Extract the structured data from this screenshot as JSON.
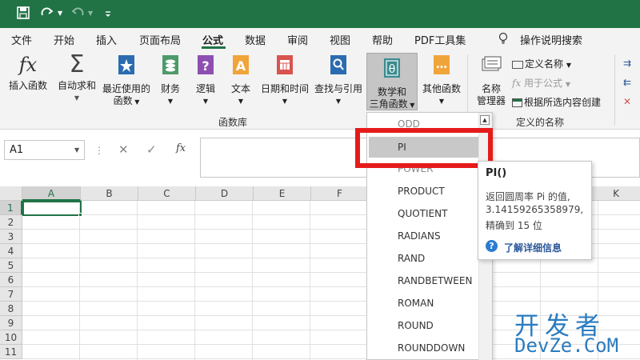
{
  "quick_access": {
    "save_icon": "save-icon",
    "redo_icon": "redo-icon",
    "undo_icon": "undo-icon",
    "customize_icon": "customize-icon"
  },
  "tabs": [
    "文件",
    "开始",
    "插入",
    "页面布局",
    "公式",
    "数据",
    "审阅",
    "视图",
    "帮助",
    "PDF工具集"
  ],
  "active_tab": "公式",
  "tell_me": "操作说明搜索",
  "ribbon": {
    "insert_function": "插入函数",
    "autosum": "自动求和",
    "recent_1": "最近使用的",
    "recent_2": "函数",
    "financial": "财务",
    "logical": "逻辑",
    "text": "文本",
    "datetime": "日期和时间",
    "lookup": "查找与引用",
    "math_1": "数学和",
    "math_2": "三角函数",
    "other": "其他函数",
    "name_mgr_1": "名称",
    "name_mgr_2": "管理器",
    "define_name": "定义名称",
    "use_in_formula": "用于公式",
    "create_from_sel": "根据所选内容创建",
    "group_library": "函数库",
    "group_names": "定义的名称"
  },
  "formula_bar": {
    "name_box": "A1",
    "fx": "fx"
  },
  "columns": [
    "A",
    "B",
    "C",
    "D",
    "E",
    "F",
    "K"
  ],
  "rows": [
    "1",
    "2",
    "3",
    "4",
    "5",
    "6",
    "7",
    "8",
    "9",
    "10",
    "11"
  ],
  "dropdown": {
    "items": [
      "ODD",
      "PI",
      "POWER",
      "PRODUCT",
      "QUOTIENT",
      "RADIANS",
      "RAND",
      "RANDBETWEEN",
      "ROMAN",
      "ROUND",
      "ROUNDDOWN"
    ],
    "selected": "PI"
  },
  "tooltip": {
    "title": "PI()",
    "line1": "返回圆周率 Pi 的值,",
    "line2": "3.14159265358979,",
    "line3": "精确到 15 位",
    "link": "了解详细信息"
  },
  "watermark": {
    "line1": "开发者",
    "line2": "DevZe.CoM"
  },
  "colors": {
    "accent": "#217346",
    "highlight": "#e51b1b",
    "link": "#2b579a"
  }
}
